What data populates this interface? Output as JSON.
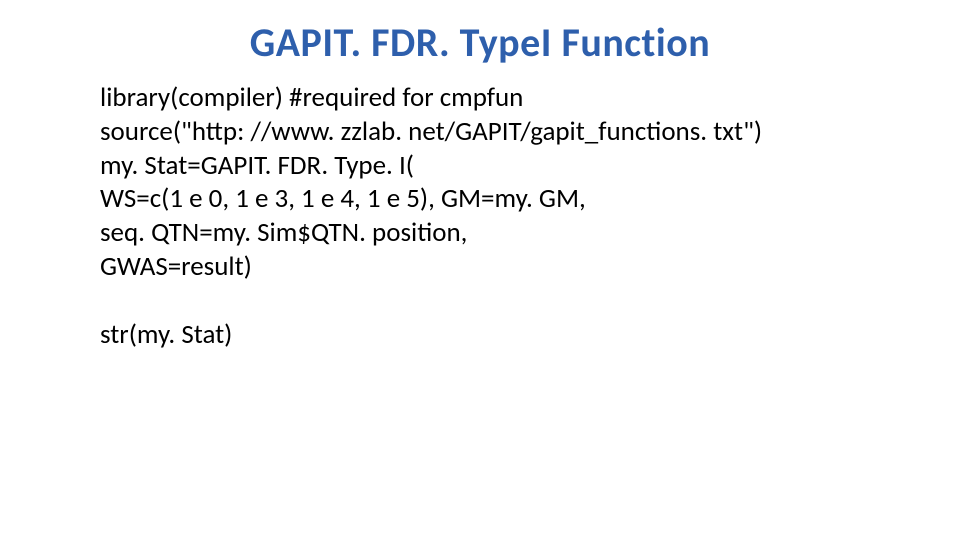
{
  "title": "GAPIT. FDR. TypeI Function",
  "code": {
    "line1": "library(compiler) #required for cmpfun",
    "line2": "source(\"http: //www. zzlab. net/GAPIT/gapit_functions. txt\")",
    "line3": "my. Stat=GAPIT. FDR. Type. I(",
    "line4": "WS=c(1 e 0, 1 e 3, 1 e 4, 1 e 5), GM=my. GM,",
    "line5": "seq. QTN=my. Sim$QTN. position,",
    "line6": "GWAS=result)",
    "line7": "str(my. Stat)"
  }
}
